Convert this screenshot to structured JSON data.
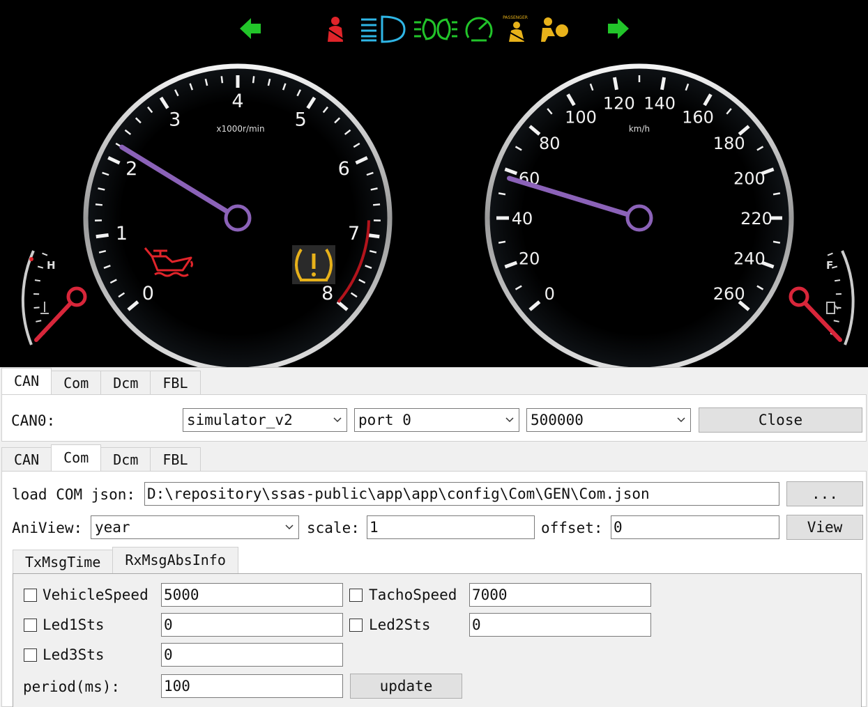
{
  "window_title": "",
  "dashboard": {
    "tacho": {
      "labels": [
        "0",
        "1",
        "2",
        "3",
        "4",
        "5",
        "6",
        "7",
        "8"
      ],
      "unit": "x1000r/min",
      "max": 8,
      "needle_value": 2.2
    },
    "speedo": {
      "labels": [
        "0",
        "20",
        "40",
        "60",
        "80",
        "100",
        "120",
        "140",
        "160",
        "180",
        "200",
        "220",
        "240",
        "260"
      ],
      "unit": "km/h",
      "max": 260,
      "needle_value": 57
    },
    "temp_gauge": {
      "hot_label": "H"
    },
    "fuel_gauge": {
      "full_label": "F"
    },
    "telltales": [
      {
        "icon": "left-turn-arrow-icon",
        "color": "#22c52a"
      },
      {
        "icon": "seatbelt-icon",
        "color": "#e0242a"
      },
      {
        "icon": "high-beam-icon",
        "color": "#2fb6e6"
      },
      {
        "icon": "parking-lights-icon",
        "color": "#22c52a"
      },
      {
        "icon": "cruise-control-icon",
        "color": "#22c52a"
      },
      {
        "icon": "passenger-seatbelt-icon",
        "color": "#e8b21a",
        "caption": "PASSENGER"
      },
      {
        "icon": "airbag-icon",
        "color": "#e8b21a"
      },
      {
        "icon": "right-turn-arrow-icon",
        "color": "#22c52a"
      }
    ],
    "oil_warning_color": "#e0242a",
    "tpms_warning_color": "#e8b21a",
    "needle_color": "#8b62b8",
    "side_needle_color": "#d8263a"
  },
  "can_panel": {
    "tabs": [
      "CAN",
      "Com",
      "Dcm",
      "FBL"
    ],
    "active_tab": "CAN",
    "channel_label": "CAN0:",
    "device": "simulator_v2",
    "port": "port 0",
    "baudrate": "500000",
    "close_label": "Close"
  },
  "com_panel": {
    "tabs": [
      "CAN",
      "Com",
      "Dcm",
      "FBL"
    ],
    "active_tab": "Com",
    "load_label": "load COM json:",
    "json_path": "D:\\repository\\ssas-public\\app\\app\\config\\Com\\GEN\\Com.json",
    "browse_label": "...",
    "aniview_label": "AniView:",
    "aniview_value": "year",
    "scale_label": "scale:",
    "scale_value": "1",
    "offset_label": "offset:",
    "offset_value": "0",
    "view_label": "View",
    "subtabs": [
      "TxMsgTime",
      "RxMsgAbsInfo"
    ],
    "active_subtab": "RxMsgAbsInfo",
    "signals": {
      "vehicle_speed": {
        "label": "VehicleSpeed",
        "value": "5000"
      },
      "tacho_speed": {
        "label": "TachoSpeed",
        "value": "7000"
      },
      "led1": {
        "label": "Led1Sts",
        "value": "0"
      },
      "led2": {
        "label": "Led2Sts",
        "value": "0"
      },
      "led3": {
        "label": "Led3Sts",
        "value": "0"
      }
    },
    "period_label": "period(ms):",
    "period_value": "100",
    "update_label": "update"
  }
}
